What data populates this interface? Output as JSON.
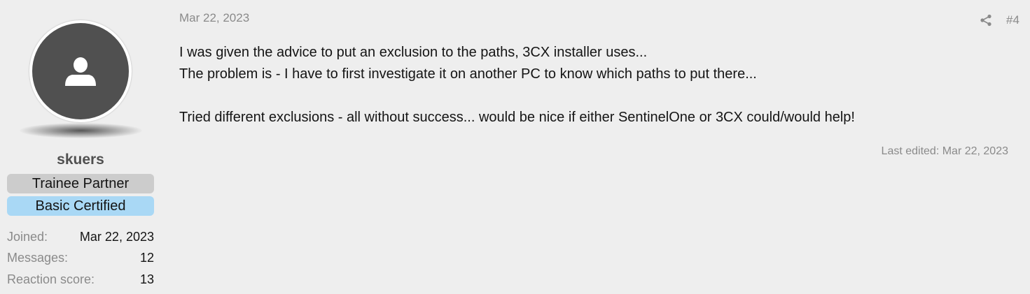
{
  "user": {
    "username": "skuers",
    "banners": {
      "trainee": "Trainee Partner",
      "basic": "Basic Certified"
    },
    "stats": {
      "joined_label": "Joined:",
      "joined_value": "Mar 22, 2023",
      "messages_label": "Messages:",
      "messages_value": "12",
      "reaction_label": "Reaction score:",
      "reaction_value": "13"
    },
    "avatar_icon": "user-silhouette-icon"
  },
  "post": {
    "date": "Mar 22, 2023",
    "number": "#4",
    "share_icon": "share-icon",
    "lines": [
      "I was given the advice to put an exclusion to the paths, 3CX installer uses...",
      "The problem is - I have to first investigate it on another PC to know which paths to put there...",
      "Tried different exclusions - all without success... would be nice if either SentinelOne or 3CX could/would help!"
    ],
    "last_edited": "Last edited: Mar 22, 2023"
  },
  "colors": {
    "background": "#eeeeee",
    "avatar": "#505050",
    "muted_text": "#8a8a8a",
    "trainee_banner": "#cccccc",
    "basic_banner": "#a9d8f5"
  }
}
